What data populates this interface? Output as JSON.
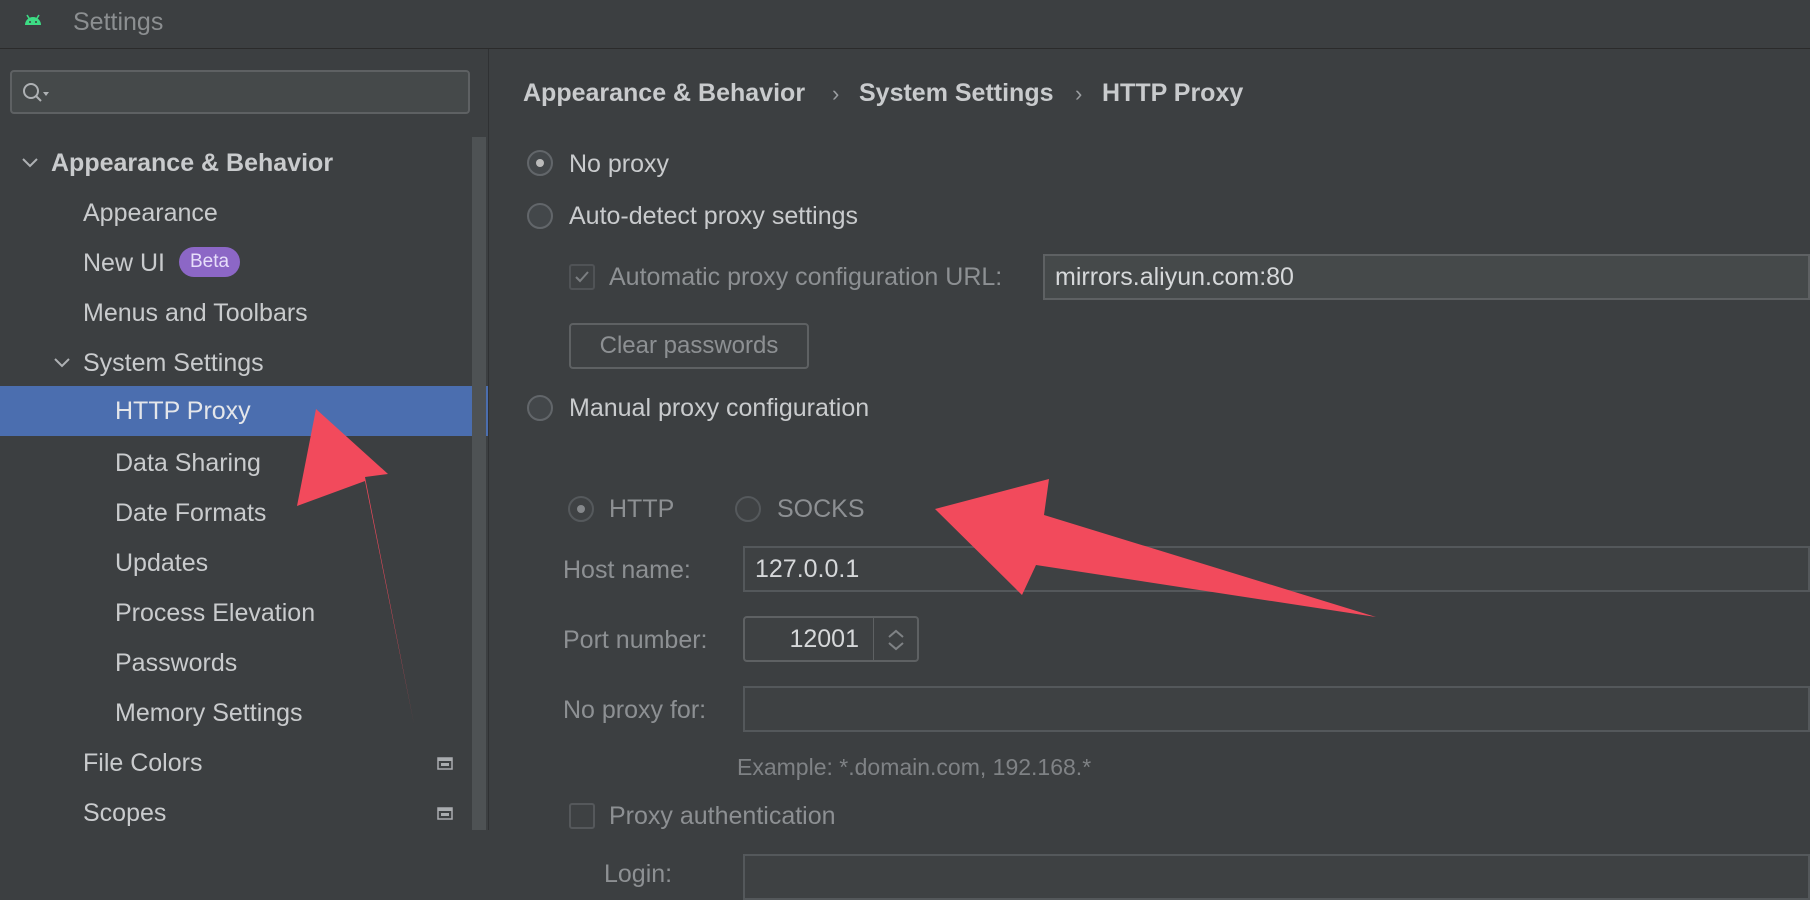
{
  "window": {
    "title": "Settings",
    "app_icon": "android-icon"
  },
  "search": {
    "placeholder": "",
    "value": ""
  },
  "sidebar": {
    "items": [
      {
        "label": "Appearance & Behavior",
        "level": 0,
        "expanded": true
      },
      {
        "label": "Appearance",
        "level": 1
      },
      {
        "label": "New UI",
        "level": 1,
        "badge": "Beta"
      },
      {
        "label": "Menus and Toolbars",
        "level": 1
      },
      {
        "label": "System Settings",
        "level": 1,
        "expanded": true
      },
      {
        "label": "HTTP Proxy",
        "level": 2,
        "selected": true
      },
      {
        "label": "Data Sharing",
        "level": 2
      },
      {
        "label": "Date Formats",
        "level": 2
      },
      {
        "label": "Updates",
        "level": 2
      },
      {
        "label": "Process Elevation",
        "level": 2
      },
      {
        "label": "Passwords",
        "level": 2
      },
      {
        "label": "Memory Settings",
        "level": 2
      },
      {
        "label": "File Colors",
        "level": 1,
        "icon": "project-level-icon"
      },
      {
        "label": "Scopes",
        "level": 1,
        "icon": "project-level-icon"
      }
    ]
  },
  "breadcrumb": {
    "items": [
      "Appearance & Behavior",
      "System Settings",
      "HTTP Proxy"
    ],
    "separator": "›"
  },
  "proxy": {
    "no_proxy_label": "No proxy",
    "no_proxy_selected": true,
    "auto_detect_label": "Auto-detect proxy settings",
    "auto_config_url_label": "Automatic proxy configuration URL:",
    "auto_config_url_checked": true,
    "auto_config_url_value": "mirrors.aliyun.com:80",
    "clear_passwords_label": "Clear passwords",
    "manual_label": "Manual proxy configuration",
    "http_label": "HTTP",
    "socks_label": "SOCKS",
    "host_label": "Host name:",
    "host_value": "127.0.0.1",
    "port_label": "Port number:",
    "port_value": "12001",
    "no_proxy_for_label": "No proxy for:",
    "no_proxy_for_value": "",
    "example_text": "Example: *.domain.com, 192.168.*",
    "auth_label": "Proxy authentication",
    "login_label": "Login:"
  },
  "colors": {
    "background": "#3c3f41",
    "selection": "#4b6eaf",
    "badge": "#8c67c6",
    "annotation_arrow": "#f24a5c"
  }
}
